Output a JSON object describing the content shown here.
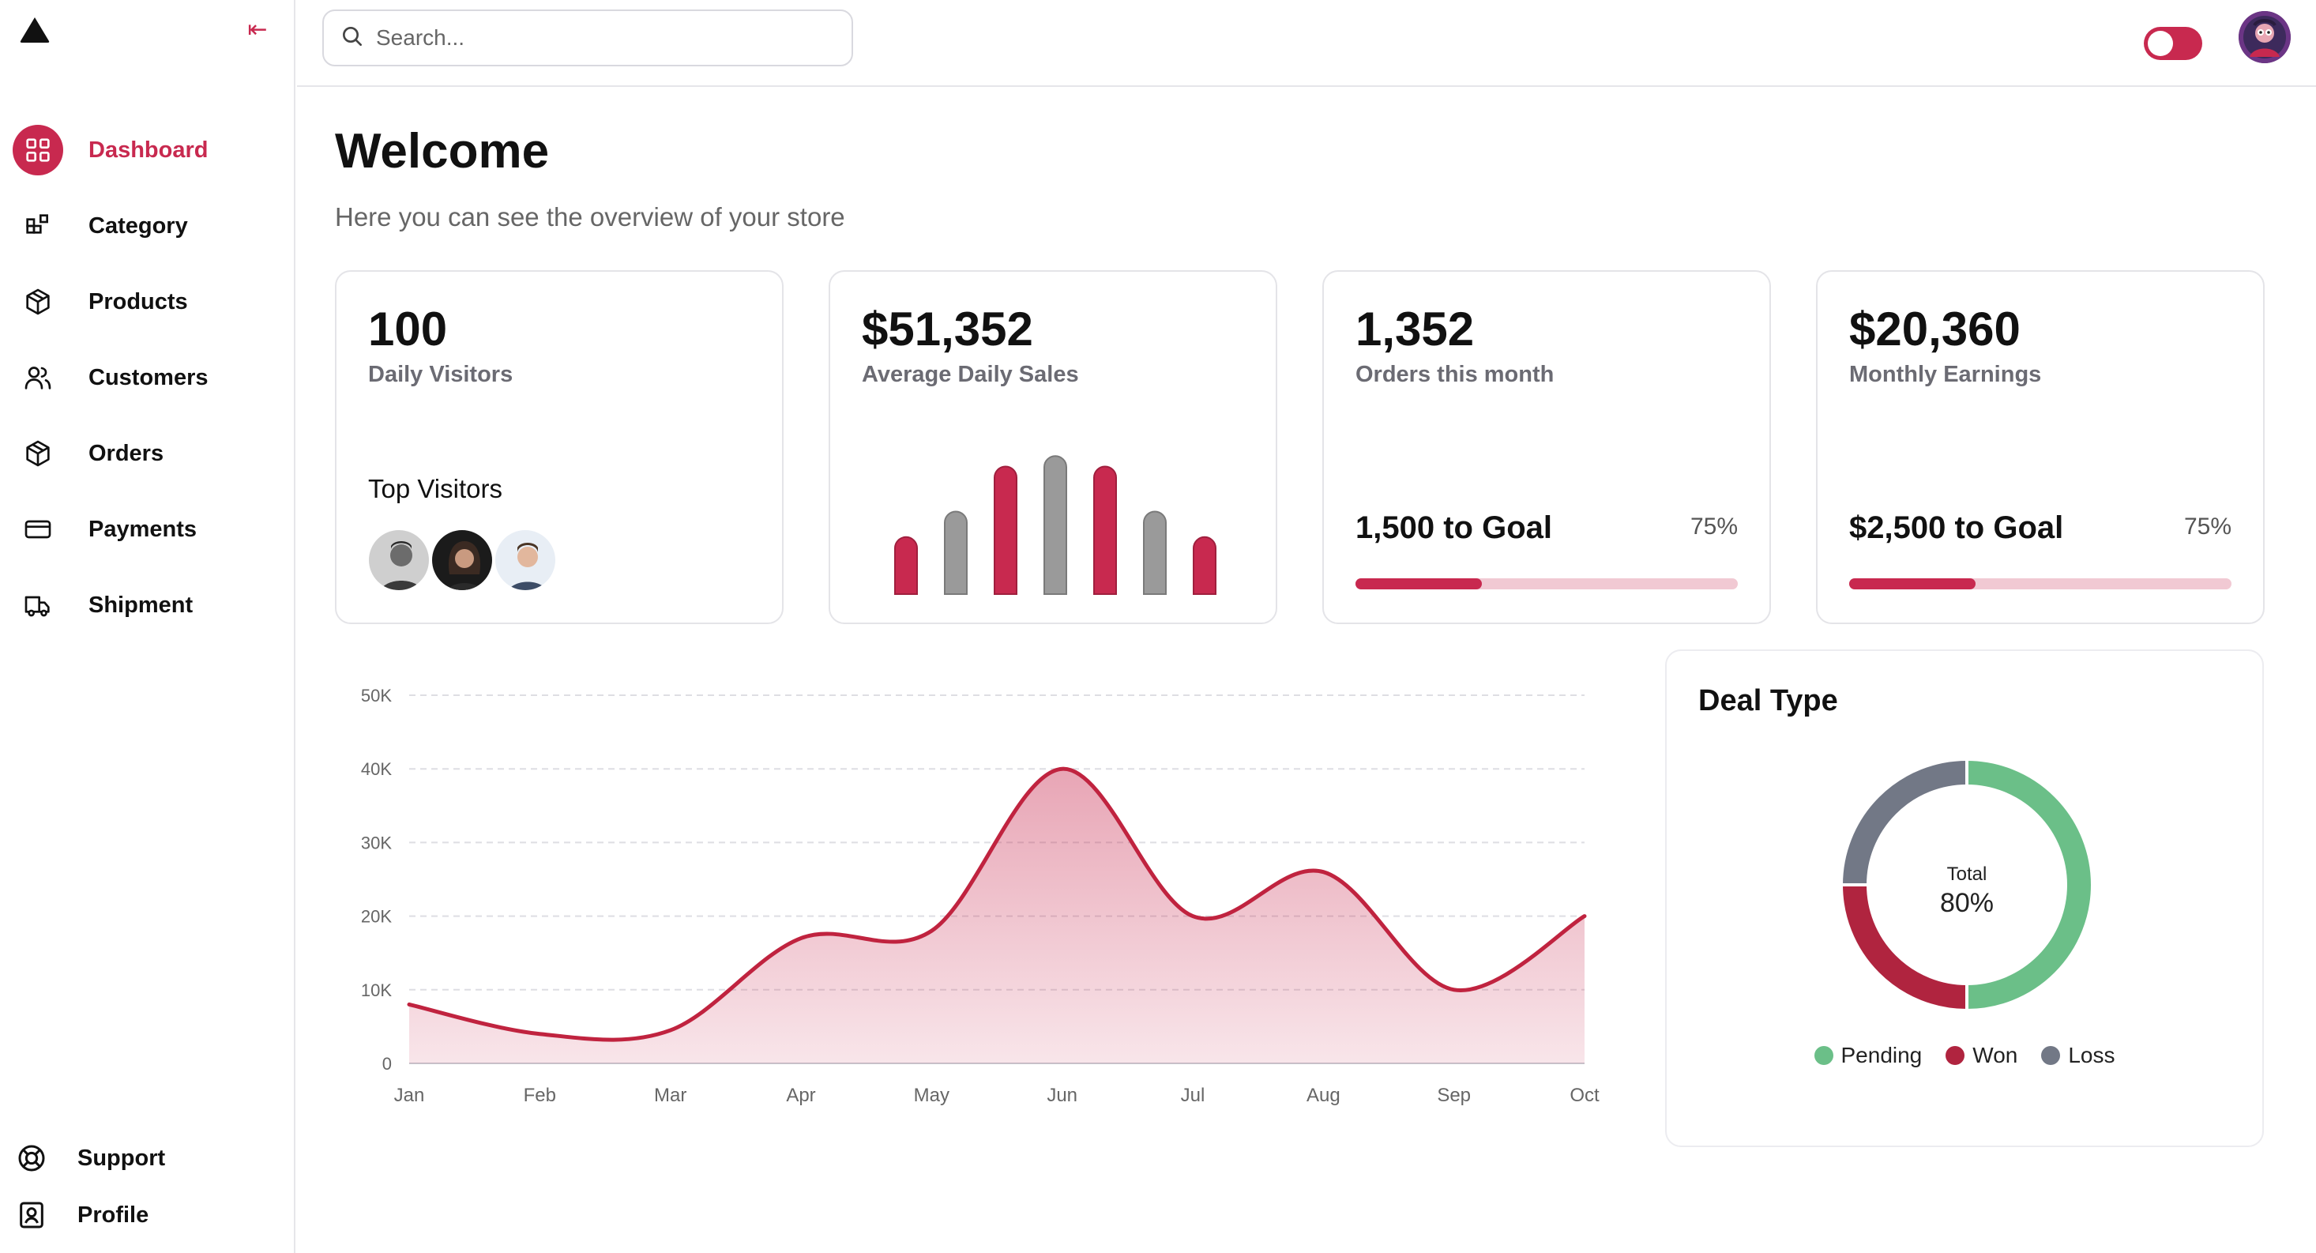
{
  "app": {
    "logo_icon": "triangle-logo-icon",
    "collapse_icon": "collapse-left-arrow-icon",
    "collapse_glyph": "⇤"
  },
  "search": {
    "placeholder": "Search..."
  },
  "sidebar": {
    "items": [
      {
        "label": "Dashboard",
        "icon": "grid-icon",
        "active": true
      },
      {
        "label": "Category",
        "icon": "category-icon",
        "active": false
      },
      {
        "label": "Products",
        "icon": "box-icon",
        "active": false
      },
      {
        "label": "Customers",
        "icon": "users-icon",
        "active": false
      },
      {
        "label": "Orders",
        "icon": "box-icon",
        "active": false
      },
      {
        "label": "Payments",
        "icon": "card-icon",
        "active": false
      },
      {
        "label": "Shipment",
        "icon": "truck-icon",
        "active": false
      }
    ],
    "bottom_items": [
      {
        "label": "Support",
        "icon": "lifebuoy-icon"
      },
      {
        "label": "Profile",
        "icon": "profile-icon"
      }
    ]
  },
  "main": {
    "title": "Welcome",
    "subtitle": "Here you can see the overview of your store"
  },
  "cards": {
    "visitors": {
      "value": "100",
      "label": "Daily Visitors",
      "top_label": "Top Visitors"
    },
    "sales": {
      "value": "$51,352",
      "label": "Average Daily Sales"
    },
    "orders": {
      "value": "1,352",
      "label": "Orders this month",
      "goal": "1,500 to Goal",
      "percent": "75%"
    },
    "earnings": {
      "value": "$20,360",
      "label": "Monthly Earnings",
      "goal": "$2,500 to Goal",
      "percent": "75%"
    }
  },
  "colors": {
    "accent": "#c8294f",
    "gray_bar": "#9a9a9a",
    "pending": "#6bbf88",
    "won": "#b0243f",
    "loss": "#727886"
  },
  "chart_data": [
    {
      "type": "bar",
      "categories": [
        "",
        "",
        "",
        "",
        "",
        "",
        ""
      ],
      "values": [
        38,
        55,
        85,
        92,
        85,
        55,
        38
      ],
      "bar_colors": [
        "accent",
        "gray",
        "accent",
        "gray",
        "accent",
        "gray",
        "accent"
      ],
      "title": "",
      "xlabel": "",
      "ylabel": "",
      "ylim": [
        0,
        100
      ],
      "grid": false
    },
    {
      "type": "area",
      "x": [
        "Jan",
        "Feb",
        "Mar",
        "Apr",
        "May",
        "Jun",
        "Jul",
        "Aug",
        "Sep",
        "Oct"
      ],
      "values": [
        8000,
        4000,
        4500,
        17000,
        18000,
        40000,
        20000,
        26000,
        10000,
        20000
      ],
      "yticks": [
        "0",
        "10K",
        "20K",
        "30K",
        "40K",
        "50K"
      ],
      "ylim": [
        0,
        50000
      ],
      "title": "",
      "xlabel": "",
      "ylabel": "",
      "grid": true
    },
    {
      "type": "pie",
      "title": "Deal Type",
      "center_label": "Total",
      "center_value": "80%",
      "slices": [
        {
          "name": "Pending",
          "value": 50
        },
        {
          "name": "Won",
          "value": 25
        },
        {
          "name": "Loss",
          "value": 25
        }
      ],
      "legend_position": "bottom"
    }
  ]
}
